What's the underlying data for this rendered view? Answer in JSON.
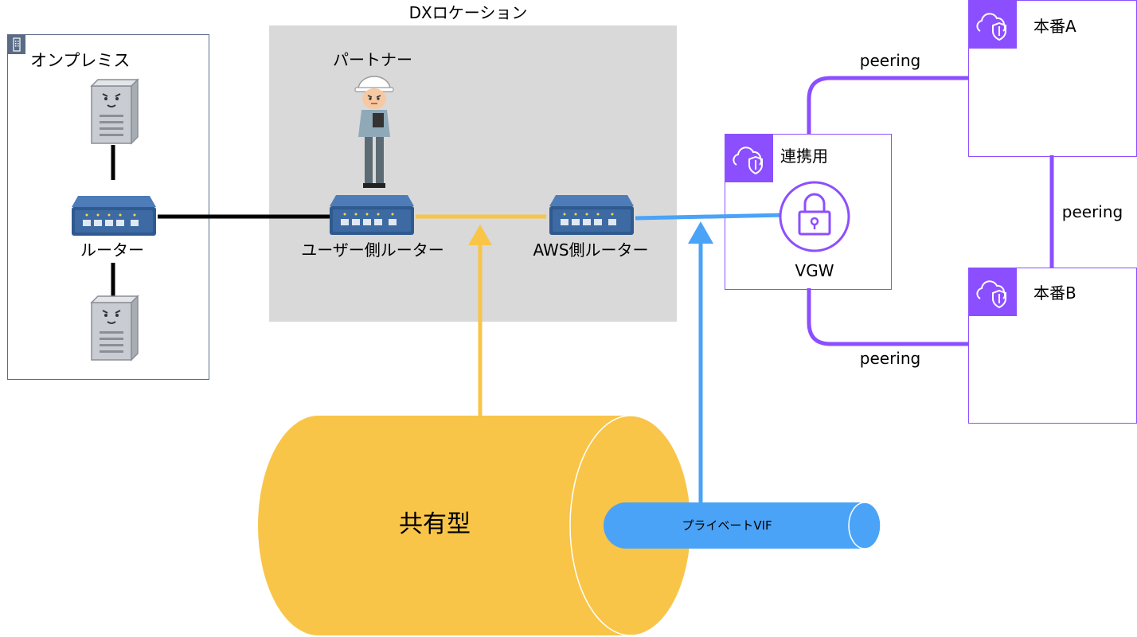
{
  "diagram": {
    "onprem": {
      "title": "オンプレミス",
      "router_label": "ルーター"
    },
    "dx_location": {
      "title": "DXロケーション",
      "partner_label": "パートナー",
      "user_router_label": "ユーザー側ルーター",
      "aws_router_label": "AWS側ルーター"
    },
    "vpcs": {
      "link": {
        "title": "連携用",
        "vgw_label": "VGW"
      },
      "prod_a": {
        "title": "本番A"
      },
      "prod_b": {
        "title": "本番B"
      }
    },
    "peerings": {
      "link_to_a": "peering",
      "a_to_b": "peering",
      "link_to_b": "peering"
    },
    "connection": {
      "shared_label": "共有型",
      "vif_label": "プライベートVIF"
    },
    "colors": {
      "hosted_yellow": "#f8c548",
      "vif_blue": "#4aa3f7",
      "vpc_purple": "#8c4fff",
      "dx_gray": "#d9d9d9",
      "router_blue": "#2f5a8f",
      "onprem_border": "#5a6b86"
    },
    "icons": [
      "building-icon",
      "server-icon",
      "router-icon",
      "worker-icon",
      "cloud-shield-icon",
      "lock-icon"
    ]
  }
}
